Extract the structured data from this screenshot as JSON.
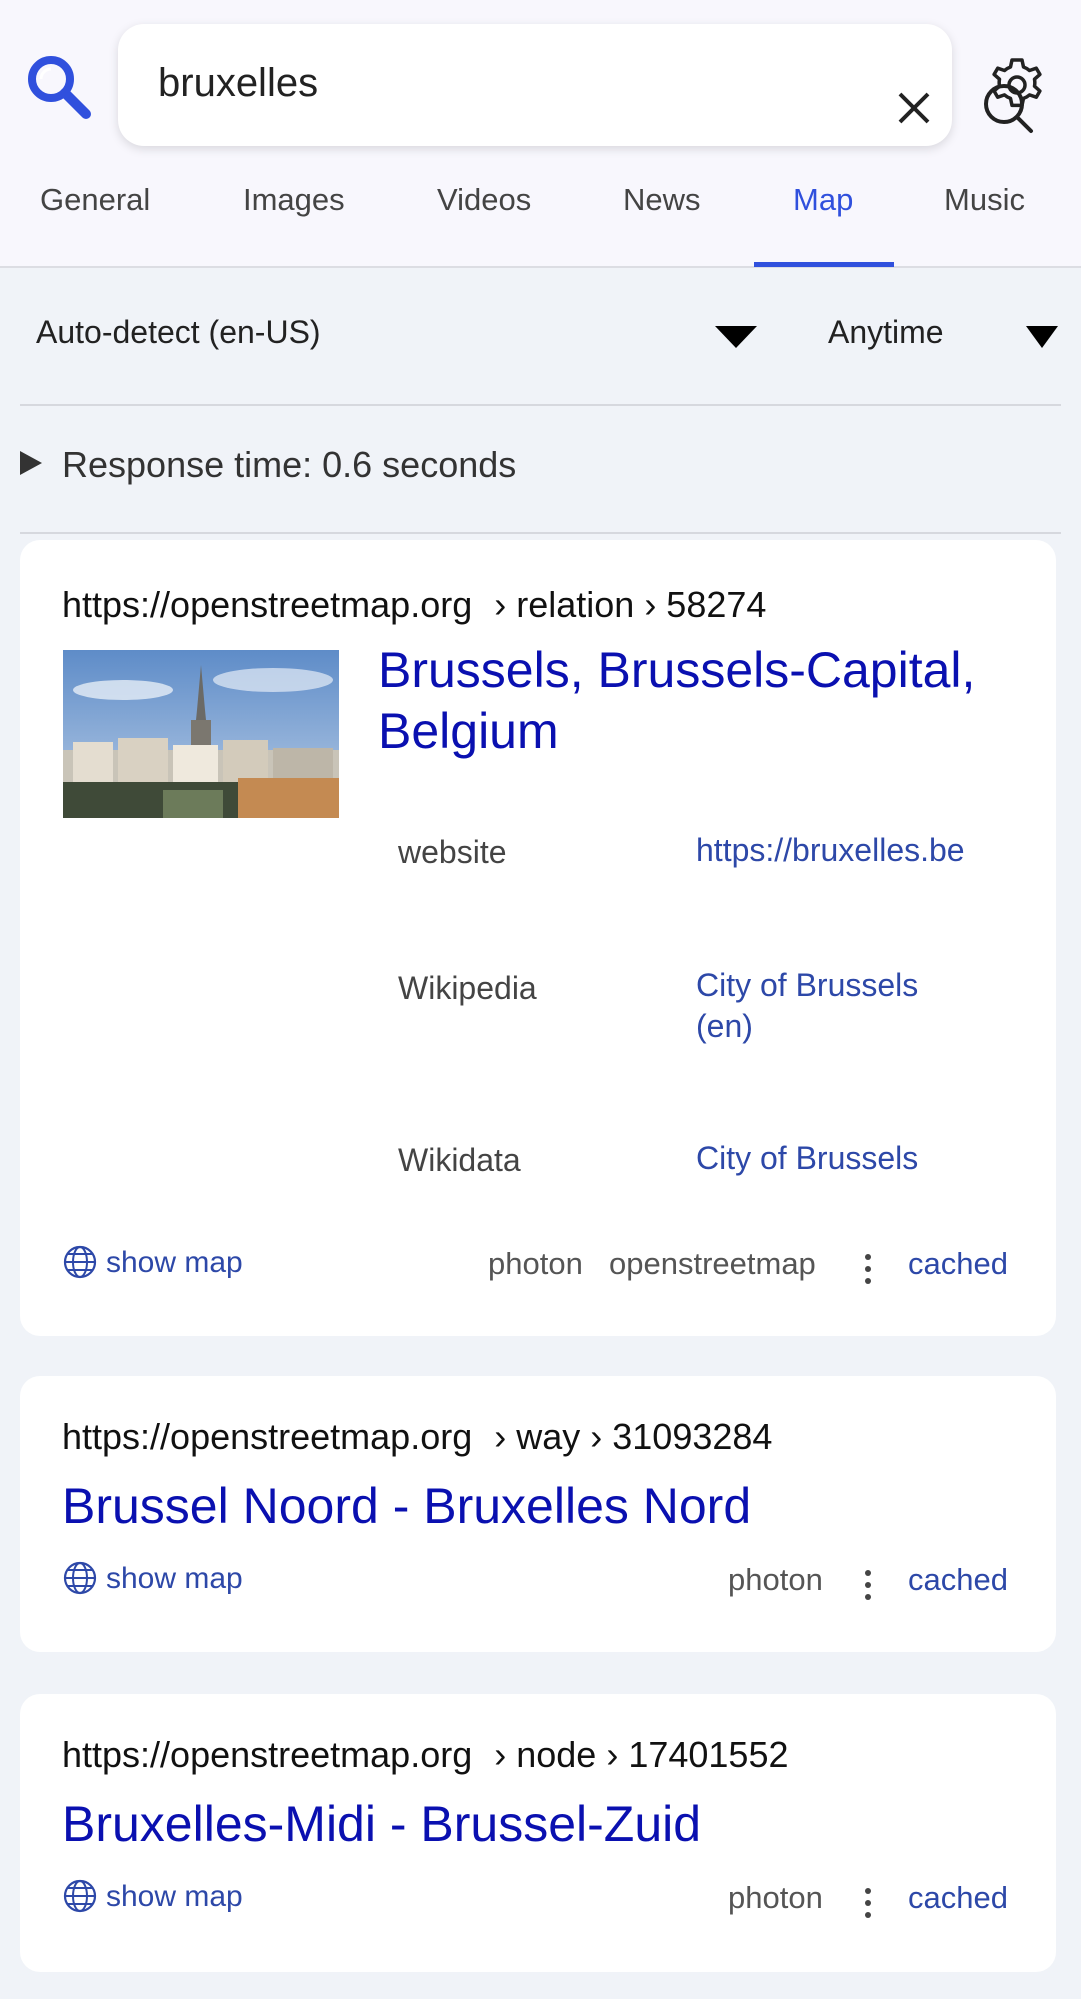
{
  "search": {
    "query": "bruxelles"
  },
  "tabs": [
    {
      "label": "General"
    },
    {
      "label": "Images"
    },
    {
      "label": "Videos"
    },
    {
      "label": "News"
    },
    {
      "label": "Map",
      "active": true
    },
    {
      "label": "Music"
    }
  ],
  "filters": {
    "language": "Auto-detect (en-US)",
    "time": "Anytime"
  },
  "response_time": "Response time: 0.6 seconds",
  "colors": {
    "accent": "#3050dd",
    "title_link": "#0a10b0",
    "link": "#2d48a8",
    "background": "#f0f3f8"
  },
  "results": [
    {
      "url_base": "https://openstreetmap.org",
      "url_path": "› relation › 58274",
      "title_line1": "Brussels, Brussels-Capital,",
      "title_line2": "Belgium",
      "fields": [
        {
          "key": "website",
          "value": "https://bruxelles.be"
        },
        {
          "key": "Wikipedia",
          "value_line1": "City of Brussels",
          "value_line2": "(en)"
        },
        {
          "key": "Wikidata",
          "value": "City of Brussels"
        }
      ],
      "show_map": "show map",
      "engines": [
        "photon",
        "openstreetmap"
      ],
      "cached": "cached"
    },
    {
      "url_base": "https://openstreetmap.org",
      "url_path": "› way › 31093284",
      "title": "Brussel Noord - Bruxelles Nord",
      "show_map": "show map",
      "engines": [
        "photon"
      ],
      "cached": "cached"
    },
    {
      "url_base": "https://openstreetmap.org",
      "url_path": "› node › 17401552",
      "title": "Bruxelles-Midi - Brussel-Zuid",
      "show_map": "show map",
      "engines": [
        "photon"
      ],
      "cached": "cached"
    }
  ]
}
